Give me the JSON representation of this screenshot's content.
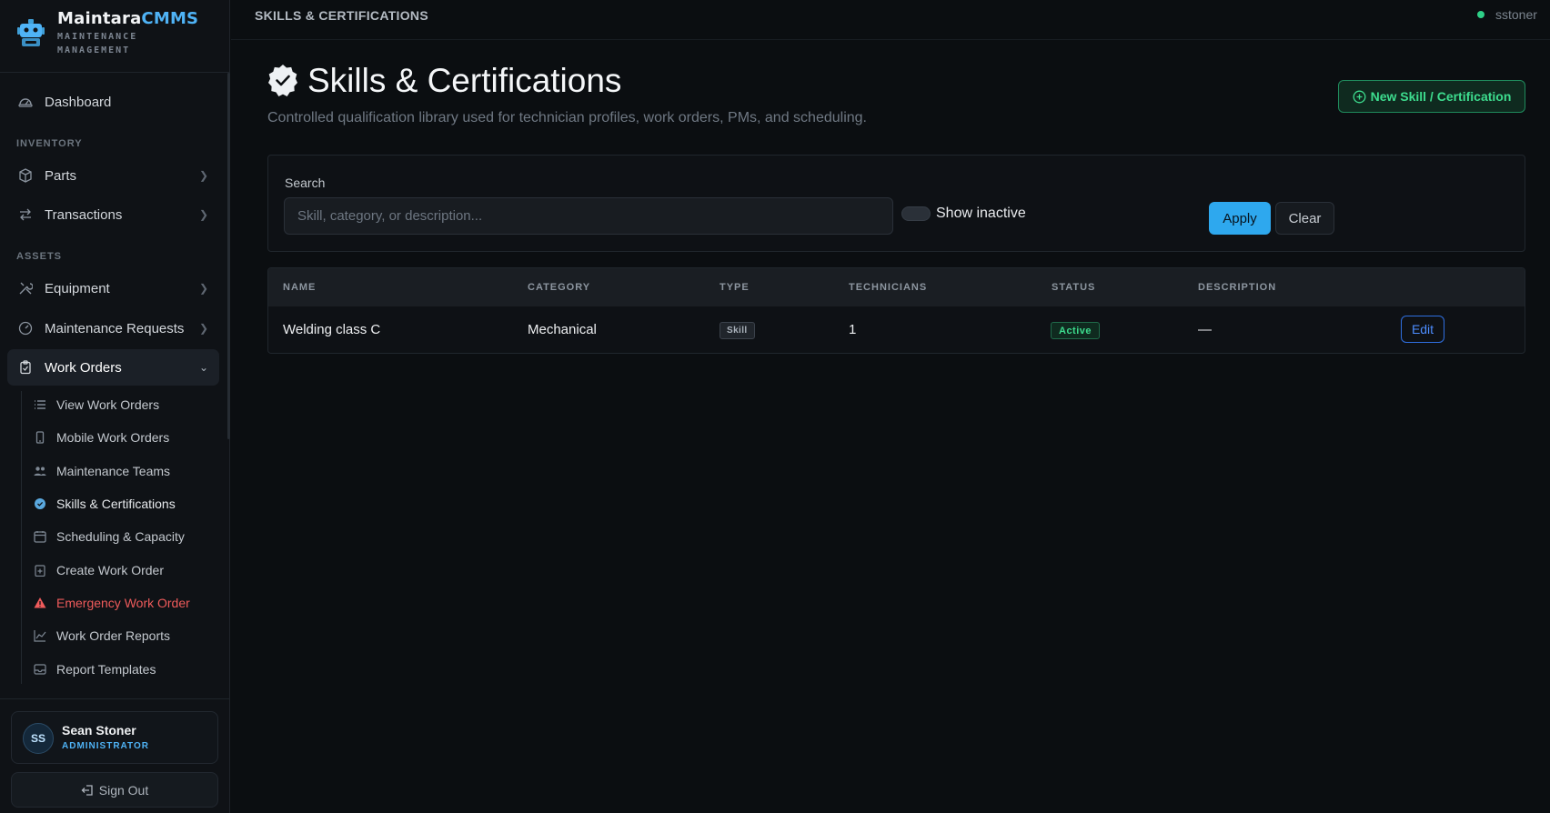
{
  "brand": {
    "name_primary": "Maintara",
    "name_accent": "CMMS",
    "subtitle": "MAINTENANCE MANAGEMENT"
  },
  "sidebar": {
    "dashboard": "Dashboard",
    "section_inventory": "INVENTORY",
    "parts": "Parts",
    "transactions": "Transactions",
    "section_assets": "ASSETS",
    "equipment": "Equipment",
    "maintenance_requests": "Maintenance Requests",
    "work_orders": "Work Orders",
    "sub_items": [
      {
        "label": "View Work Orders",
        "icon": "list-icon"
      },
      {
        "label": "Mobile Work Orders",
        "icon": "mobile-icon"
      },
      {
        "label": "Maintenance Teams",
        "icon": "team-icon"
      },
      {
        "label": "Skills & Certifications",
        "icon": "badge-icon"
      },
      {
        "label": "Scheduling & Capacity",
        "icon": "calendar-icon"
      },
      {
        "label": "Create Work Order",
        "icon": "clipboard-plus-icon"
      },
      {
        "label": "Emergency Work Order",
        "icon": "warning-icon"
      },
      {
        "label": "Work Order Reports",
        "icon": "chart-line-icon"
      },
      {
        "label": "Report Templates",
        "icon": "template-icon"
      }
    ]
  },
  "user": {
    "initials": "SS",
    "name": "Sean Stoner",
    "role": "ADMINISTRATOR",
    "signout": "Sign Out"
  },
  "topbar": {
    "breadcrumb": "SKILLS & CERTIFICATIONS",
    "username": "sstoner"
  },
  "page": {
    "title": "Skills & Certifications",
    "subtitle": "Controlled qualification library used for technician profiles, work orders, PMs, and scheduling.",
    "new_button": "New Skill / Certification"
  },
  "filters": {
    "search_label": "Search",
    "search_placeholder": "Skill, category, or description...",
    "show_inactive": "Show inactive",
    "apply": "Apply",
    "clear": "Clear"
  },
  "table": {
    "headers": {
      "name": "NAME",
      "category": "CATEGORY",
      "type": "TYPE",
      "technicians": "TECHNICIANS",
      "status": "STATUS",
      "description": "DESCRIPTION"
    },
    "rows": [
      {
        "name": "Welding class C",
        "category": "Mechanical",
        "type": "Skill",
        "technicians": "1",
        "status": "Active",
        "description": "—",
        "action": "Edit"
      }
    ]
  },
  "colors": {
    "accent": "#4fb3f6",
    "success": "#3ddc8e",
    "danger": "#ef5b5b",
    "background": "#0b0e11"
  }
}
